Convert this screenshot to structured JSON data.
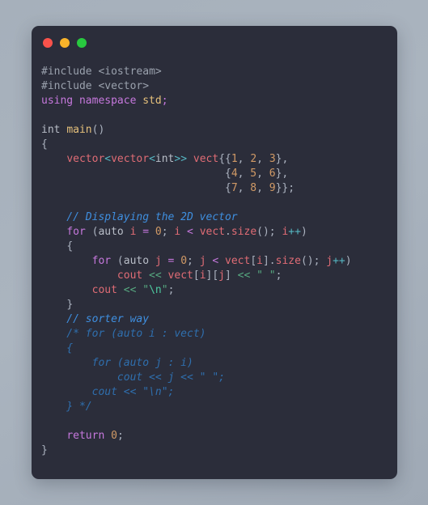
{
  "window": {
    "controls": [
      {
        "name": "close",
        "color": "#f9524b"
      },
      {
        "name": "minimize",
        "color": "#f8b32a"
      },
      {
        "name": "maximize",
        "color": "#28c93f"
      }
    ]
  },
  "theme": {
    "page_background": "#a8b2bd",
    "card_background": "#2b2d3a",
    "keyword": "#c678dd",
    "type": "#e06c75",
    "function": "#e5c07b",
    "number": "#d19a66",
    "string": "#57a980",
    "operator": "#56b6c2",
    "comment": "#3f8fe0",
    "plain": "#b9bec8"
  },
  "code": {
    "language": "C++",
    "lines": [
      {
        "id": 1,
        "text": "#include <iostream>"
      },
      {
        "id": 2,
        "text": "#include <vector>"
      },
      {
        "id": 3,
        "text": "using namespace std;"
      },
      {
        "id": 4,
        "text": ""
      },
      {
        "id": 5,
        "text": "int main()"
      },
      {
        "id": 6,
        "text": "{"
      },
      {
        "id": 7,
        "text": "    vector<vector<int>> vect{{1, 2, 3},"
      },
      {
        "id": 8,
        "text": "                             {4, 5, 6},"
      },
      {
        "id": 9,
        "text": "                             {7, 8, 9}};"
      },
      {
        "id": 10,
        "text": ""
      },
      {
        "id": 11,
        "text": "    // Displaying the 2D vector"
      },
      {
        "id": 12,
        "text": "    for (auto i = 0; i < vect.size(); i++)"
      },
      {
        "id": 13,
        "text": "    {"
      },
      {
        "id": 14,
        "text": "        for (auto j = 0; j < vect[i].size(); j++)"
      },
      {
        "id": 15,
        "text": "            cout << vect[i][j] << \" \";"
      },
      {
        "id": 16,
        "text": "        cout << \"\\n\";"
      },
      {
        "id": 17,
        "text": "    }"
      },
      {
        "id": 18,
        "text": "    // sorter way"
      },
      {
        "id": 19,
        "text": "    /* for (auto i : vect)"
      },
      {
        "id": 20,
        "text": "    {"
      },
      {
        "id": 21,
        "text": "        for (auto j : i)"
      },
      {
        "id": 22,
        "text": "            cout << j << \" \";"
      },
      {
        "id": 23,
        "text": "        cout << \"\\n\";"
      },
      {
        "id": 24,
        "text": "    } */"
      },
      {
        "id": 25,
        "text": ""
      },
      {
        "id": 26,
        "text": "    return 0;"
      },
      {
        "id": 27,
        "text": "}"
      }
    ],
    "tokens": {
      "l1": [
        [
          "pre",
          "#include "
        ],
        [
          "pre",
          "<iostream>"
        ]
      ],
      "l2": [
        [
          "pre",
          "#include "
        ],
        [
          "pre",
          "<vector>"
        ]
      ],
      "l3": [
        [
          "kw",
          "using namespace "
        ],
        [
          "fn",
          "std"
        ],
        [
          "kw",
          ";"
        ]
      ],
      "l5": [
        [
          "plain",
          "int "
        ],
        [
          "fn",
          "main"
        ],
        [
          "punct",
          "()"
        ]
      ],
      "l6": [
        [
          "punct",
          "{"
        ]
      ],
      "l7": [
        [
          "plain",
          "    "
        ],
        [
          "type",
          "vector"
        ],
        [
          "op",
          "<"
        ],
        [
          "type",
          "vector"
        ],
        [
          "op",
          "<"
        ],
        [
          "plain",
          "int"
        ],
        [
          "op",
          ">>"
        ],
        [
          "plain",
          " "
        ],
        [
          "type",
          "vect"
        ],
        [
          "punct",
          "{{"
        ],
        [
          "num",
          "1"
        ],
        [
          "punct",
          ", "
        ],
        [
          "num",
          "2"
        ],
        [
          "punct",
          ", "
        ],
        [
          "num",
          "3"
        ],
        [
          "punct",
          "},"
        ]
      ],
      "l8": [
        [
          "plain",
          "                             "
        ],
        [
          "punct",
          "{"
        ],
        [
          "num",
          "4"
        ],
        [
          "punct",
          ", "
        ],
        [
          "num",
          "5"
        ],
        [
          "punct",
          ", "
        ],
        [
          "num",
          "6"
        ],
        [
          "punct",
          "},"
        ]
      ],
      "l9": [
        [
          "plain",
          "                             "
        ],
        [
          "punct",
          "{"
        ],
        [
          "num",
          "7"
        ],
        [
          "punct",
          ", "
        ],
        [
          "num",
          "8"
        ],
        [
          "punct",
          ", "
        ],
        [
          "num",
          "9"
        ],
        [
          "punct",
          "}};"
        ]
      ],
      "l11": [
        [
          "cmt",
          "    // Displaying the 2D vector"
        ]
      ],
      "l12": [
        [
          "plain",
          "    "
        ],
        [
          "kw",
          "for"
        ],
        [
          "punct",
          " ("
        ],
        [
          "plain",
          "auto "
        ],
        [
          "var",
          "i"
        ],
        [
          "kw",
          " = "
        ],
        [
          "num",
          "0"
        ],
        [
          "punct",
          "; "
        ],
        [
          "var",
          "i"
        ],
        [
          "kw",
          " < "
        ],
        [
          "type",
          "vect"
        ],
        [
          "punct",
          "."
        ],
        [
          "type",
          "size"
        ],
        [
          "punct",
          "(); "
        ],
        [
          "var",
          "i"
        ],
        [
          "op",
          "++"
        ],
        [
          "punct",
          ")"
        ]
      ],
      "l13": [
        [
          "plain",
          "    "
        ],
        [
          "punct",
          "{"
        ]
      ],
      "l14": [
        [
          "plain",
          "        "
        ],
        [
          "kw",
          "for"
        ],
        [
          "punct",
          " ("
        ],
        [
          "plain",
          "auto "
        ],
        [
          "var",
          "j"
        ],
        [
          "kw",
          " = "
        ],
        [
          "num",
          "0"
        ],
        [
          "punct",
          "; "
        ],
        [
          "var",
          "j"
        ],
        [
          "kw",
          " < "
        ],
        [
          "type",
          "vect"
        ],
        [
          "punct",
          "["
        ],
        [
          "var",
          "i"
        ],
        [
          "punct",
          "]."
        ],
        [
          "type",
          "size"
        ],
        [
          "punct",
          "(); "
        ],
        [
          "var",
          "j"
        ],
        [
          "op",
          "++"
        ],
        [
          "punct",
          ")"
        ]
      ],
      "l15": [
        [
          "plain",
          "            "
        ],
        [
          "type",
          "cout"
        ],
        [
          "str",
          " << "
        ],
        [
          "type",
          "vect"
        ],
        [
          "punct",
          "["
        ],
        [
          "var",
          "i"
        ],
        [
          "punct",
          "]["
        ],
        [
          "var",
          "j"
        ],
        [
          "punct",
          "] "
        ],
        [
          "str",
          "<< \" \""
        ],
        [
          "punct",
          ";"
        ]
      ],
      "l16": [
        [
          "plain",
          "        "
        ],
        [
          "type",
          "cout"
        ],
        [
          "str",
          " << "
        ],
        [
          "str",
          "\""
        ],
        [
          "esc",
          "\\n"
        ],
        [
          "str",
          "\""
        ],
        [
          "punct",
          ";"
        ]
      ],
      "l17": [
        [
          "plain",
          "    "
        ],
        [
          "punct",
          "}"
        ]
      ],
      "l18": [
        [
          "cmt",
          "    // sorter way"
        ]
      ],
      "l19": [
        [
          "cmtdim",
          "    /* for (auto i : vect)"
        ]
      ],
      "l20": [
        [
          "cmtdim",
          "    {"
        ]
      ],
      "l21": [
        [
          "cmtdim",
          "        for (auto j : i)"
        ]
      ],
      "l22": [
        [
          "cmtdim",
          "            cout << j << \" \";"
        ]
      ],
      "l23": [
        [
          "cmtdim",
          "        cout << \"\\n\";"
        ]
      ],
      "l24": [
        [
          "cmtdim",
          "    } */"
        ]
      ],
      "l26": [
        [
          "plain",
          "    "
        ],
        [
          "kw",
          "return"
        ],
        [
          "plain",
          " "
        ],
        [
          "num",
          "0"
        ],
        [
          "punct",
          ";"
        ]
      ],
      "l27": [
        [
          "punct",
          "}"
        ]
      ]
    }
  }
}
